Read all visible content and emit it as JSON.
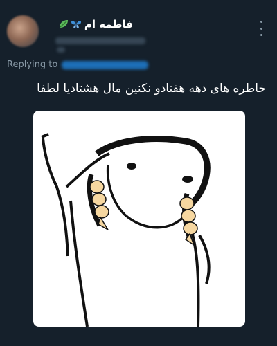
{
  "tweet": {
    "display_name": "فاطمه ام",
    "emojis": [
      "leaf-icon",
      "butterfly-icon"
    ],
    "replying_label": "Replying to",
    "text": "خاطره های دهه هفتادو نکنین مال هشتادیا لطفا"
  },
  "colors": {
    "background": "#15202b",
    "secondary_text": "#8899a6",
    "link": "#1d9bf0",
    "leaf": "#5cb85c",
    "butterfly": "#3e8fd8",
    "braid": "#f6d7a0"
  }
}
